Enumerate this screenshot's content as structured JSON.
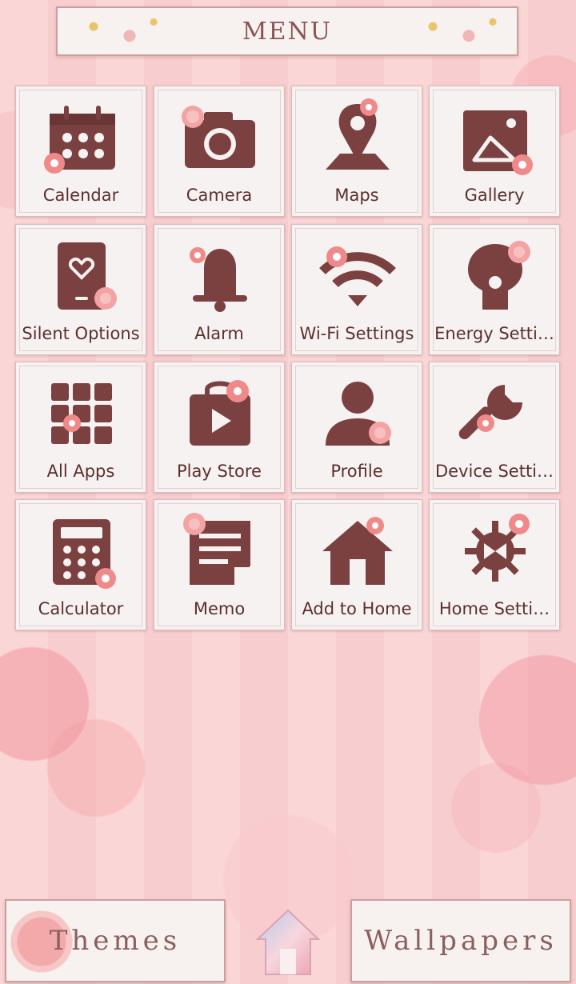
{
  "header": {
    "title": "MENU"
  },
  "menu": {
    "items": [
      {
        "label": "Calendar",
        "icon": "calendar-icon"
      },
      {
        "label": "Camera",
        "icon": "camera-icon"
      },
      {
        "label": "Maps",
        "icon": "map-pin-icon"
      },
      {
        "label": "Gallery",
        "icon": "image-icon"
      },
      {
        "label": "Silent Options",
        "icon": "silent-phone-icon"
      },
      {
        "label": "Alarm",
        "icon": "bell-icon"
      },
      {
        "label": "Wi-Fi Settings",
        "icon": "wifi-icon"
      },
      {
        "label": "Energy Setti…",
        "icon": "energy-icon"
      },
      {
        "label": "All Apps",
        "icon": "apps-grid-icon"
      },
      {
        "label": "Play Store",
        "icon": "play-store-icon"
      },
      {
        "label": "Profile",
        "icon": "person-icon"
      },
      {
        "label": "Device Setti…",
        "icon": "wrench-icon"
      },
      {
        "label": "Calculator",
        "icon": "calculator-icon"
      },
      {
        "label": "Memo",
        "icon": "memo-icon"
      },
      {
        "label": "Add to Home",
        "icon": "house-icon"
      },
      {
        "label": "Home Setti…",
        "icon": "settings-gear-icon"
      }
    ]
  },
  "footer": {
    "themes_label": "Themes",
    "wallpapers_label": "Wallpapers",
    "home_icon": "home-icon"
  },
  "colors": {
    "icon_brown": "#7b4141",
    "label_text": "#5b2f2f",
    "tile_background": "#f6f2f1",
    "flower_accent": "#f08a8a"
  }
}
